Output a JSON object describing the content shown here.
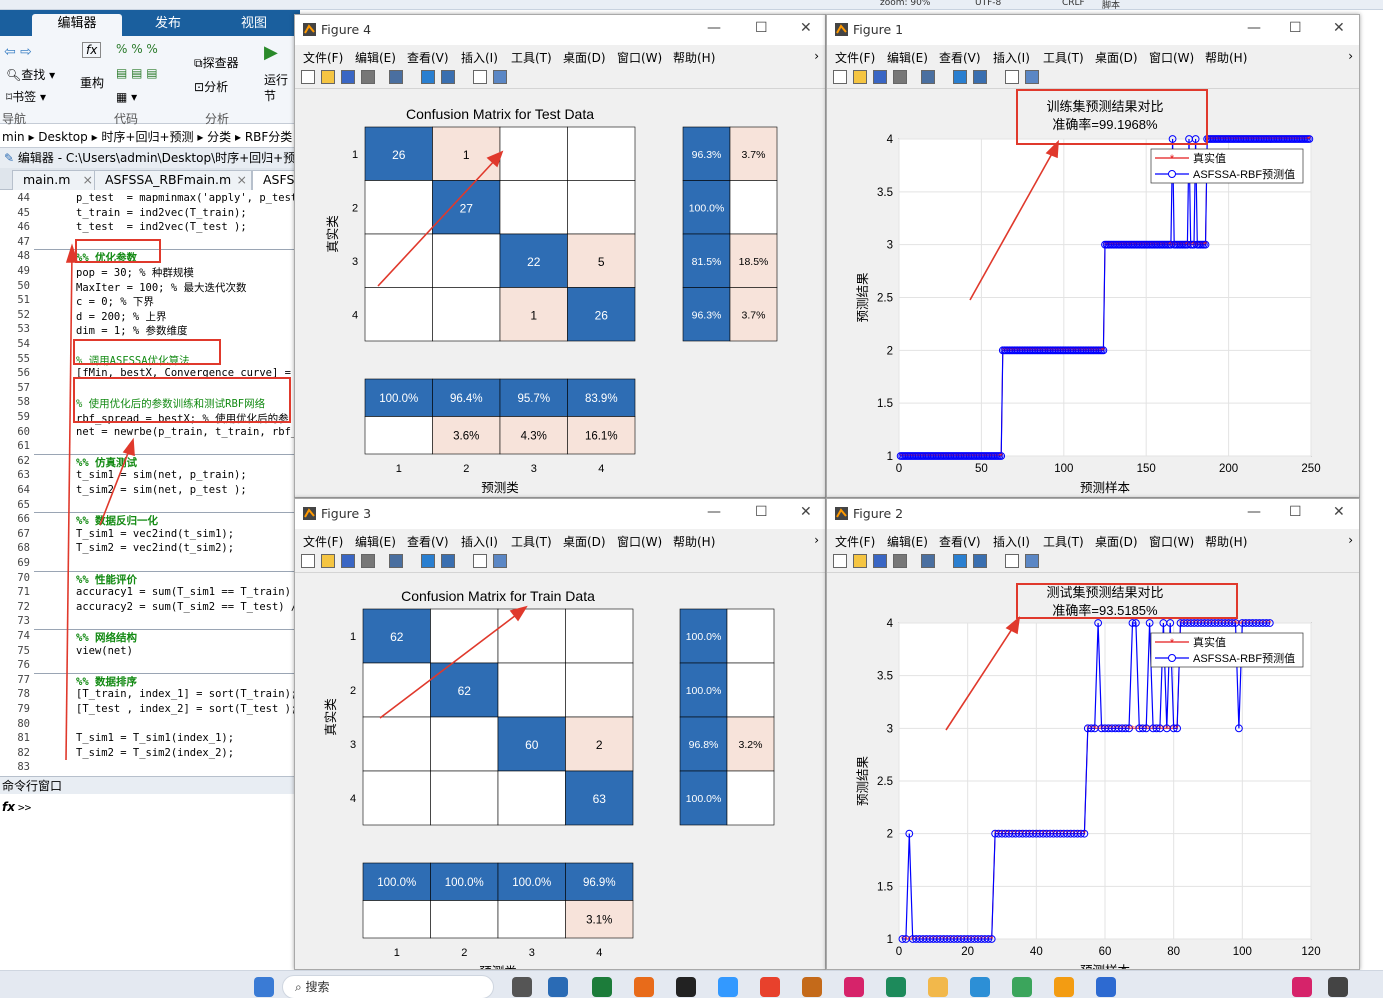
{
  "top_strip": {
    "items": [
      "zoom: 90%",
      "UTF-8",
      "CRLF",
      "脚本"
    ]
  },
  "matlab": {
    "tabs": [
      "编辑器",
      "发布",
      "视图"
    ],
    "ribbon": {
      "find": "查找",
      "bookmark": "书签",
      "refactor": "重构",
      "explorer": "探查器",
      "analyze": "分析",
      "run": "运行\n节",
      "groups": [
        "导航",
        "代码",
        "分析"
      ]
    },
    "breadcrumb": "min ▸ Desktop ▸ 时序+回归+预测 ▸ 分类 ▸ RBF分类",
    "editor_title": "编辑器 - C:\\Users\\admin\\Desktop\\时序+回归+预测\\",
    "file_tabs": [
      "main.m",
      "ASFSSA_RBFmain.m",
      "ASFSS"
    ],
    "code_lines": [
      {
        "n": "44",
        "t": "p_test  = mapminmax('apply', p_test",
        "k": "code"
      },
      {
        "n": "45",
        "t": "t_train = ind2vec(T_train);",
        "k": "code"
      },
      {
        "n": "46",
        "t": "t_test  = ind2vec(T_test );",
        "k": "code"
      },
      {
        "n": "47",
        "t": "",
        "k": "code"
      },
      {
        "n": "48",
        "t": "%% 优化参数",
        "k": "sec"
      },
      {
        "n": "49",
        "t": "pop = 30; % 种群规模",
        "k": "code"
      },
      {
        "n": "50",
        "t": "MaxIter = 100; % 最大迭代次数",
        "k": "code"
      },
      {
        "n": "51",
        "t": "c = 0; % 下界",
        "k": "code"
      },
      {
        "n": "52",
        "t": "d = 200; % 上界",
        "k": "code"
      },
      {
        "n": "53",
        "t": "dim = 1; % 参数维度",
        "k": "code"
      },
      {
        "n": "54",
        "t": "",
        "k": "code"
      },
      {
        "n": "55",
        "t": "% 调用ASFSSA优化算法",
        "k": "cm"
      },
      {
        "n": "56",
        "t": "[fMin, bestX, Convergence_curve] =",
        "k": "code"
      },
      {
        "n": "57",
        "t": "",
        "k": "code"
      },
      {
        "n": "58",
        "t": "% 使用优化后的参数训练和测试RBF网络",
        "k": "cm"
      },
      {
        "n": "59",
        "t": "rbf_spread = bestX; % 使用优化后的参",
        "k": "code"
      },
      {
        "n": "60",
        "t": "net = newrbe(p_train, t_train, rbf_",
        "k": "code"
      },
      {
        "n": "61",
        "t": "",
        "k": "code"
      },
      {
        "n": "62",
        "t": "%% 仿真测试",
        "k": "sec"
      },
      {
        "n": "63",
        "t": "t_sim1 = sim(net, p_train);",
        "k": "code"
      },
      {
        "n": "64",
        "t": "t_sim2 = sim(net, p_test );",
        "k": "code"
      },
      {
        "n": "65",
        "t": "",
        "k": "code"
      },
      {
        "n": "66",
        "t": "%% 数据反归一化",
        "k": "sec"
      },
      {
        "n": "67",
        "t": "T_sim1 = vec2ind(t_sim1);",
        "k": "code"
      },
      {
        "n": "68",
        "t": "T_sim2 = vec2ind(t_sim2);",
        "k": "code"
      },
      {
        "n": "69",
        "t": "",
        "k": "code"
      },
      {
        "n": "70",
        "t": "%% 性能评价",
        "k": "sec"
      },
      {
        "n": "71",
        "t": "accuracy1 = sum(T_sim1 == T_train)",
        "k": "code"
      },
      {
        "n": "72",
        "t": "accuracy2 = sum(T_sim2 == T_test) /",
        "k": "code"
      },
      {
        "n": "73",
        "t": "",
        "k": "code"
      },
      {
        "n": "74",
        "t": "%% 网络结构",
        "k": "sec"
      },
      {
        "n": "75",
        "t": "view(net)",
        "k": "code"
      },
      {
        "n": "76",
        "t": "",
        "k": "code"
      },
      {
        "n": "77",
        "t": "%% 数据排序",
        "k": "sec"
      },
      {
        "n": "78",
        "t": "[T_train, index_1] = sort(T_train);",
        "k": "code"
      },
      {
        "n": "79",
        "t": "[T_test , index_2] = sort(T_test );",
        "k": "code"
      },
      {
        "n": "80",
        "t": "",
        "k": "code"
      },
      {
        "n": "81",
        "t": "T_sim1 = T_sim1(index_1);",
        "k": "code"
      },
      {
        "n": "82",
        "t": "T_sim2 = T_sim2(index_2);",
        "k": "code"
      },
      {
        "n": "83",
        "t": "",
        "k": "code"
      }
    ],
    "command_window_title": "命令行窗口",
    "prompt": ">>"
  },
  "figure_menu": [
    "文件(F)",
    "编辑(E)",
    "查看(V)",
    "插入(I)",
    "工具(T)",
    "桌面(D)",
    "窗口(W)",
    "帮助(H)"
  ],
  "figures": {
    "fig4": {
      "title": "Figure 4",
      "chart_title": "Confusion Matrix for Test Data",
      "xlabel": "预测类",
      "ylabel": "真实类"
    },
    "fig3": {
      "title": "Figure 3",
      "chart_title": "Confusion Matrix for Train Data",
      "xlabel": "预测类",
      "ylabel": "真实类"
    },
    "fig1": {
      "title": "Figure 1",
      "chart_title": "训练集预测结果对比",
      "accuracy": "准确率=99.1968%",
      "xlabel": "预测样本",
      "ylabel": "预测结果",
      "legend": [
        "真实值",
        "ASFSSA-RBF预测值"
      ]
    },
    "fig2": {
      "title": "Figure 2",
      "chart_title": "测试集预测结果对比",
      "accuracy": "准确率=93.5185%",
      "xlabel": "预测样本",
      "ylabel": "预测结果",
      "legend": [
        "真实值",
        "ASFSSA-RBF预测值"
      ]
    }
  },
  "taskbar": {
    "search": "搜索"
  },
  "chart_data": [
    {
      "type": "heatmap",
      "title": "Confusion Matrix for Test Data",
      "xlabel": "预测类",
      "ylabel": "真实类",
      "classes": [
        "1",
        "2",
        "3",
        "4"
      ],
      "matrix": [
        [
          26,
          1,
          0,
          0
        ],
        [
          0,
          27,
          0,
          0
        ],
        [
          0,
          0,
          22,
          5
        ],
        [
          0,
          0,
          1,
          26
        ]
      ],
      "row_summary": [
        [
          "96.3%",
          "3.7%"
        ],
        [
          "100.0%",
          ""
        ],
        [
          "81.5%",
          "18.5%"
        ],
        [
          "96.3%",
          "3.7%"
        ]
      ],
      "col_summary": [
        [
          "100.0%",
          ""
        ],
        [
          "96.4%",
          "3.6%"
        ],
        [
          "95.7%",
          "4.3%"
        ],
        [
          "83.9%",
          "16.1%"
        ]
      ]
    },
    {
      "type": "heatmap",
      "title": "Confusion Matrix for Train Data",
      "xlabel": "预测类",
      "ylabel": "真实类",
      "classes": [
        "1",
        "2",
        "3",
        "4"
      ],
      "matrix": [
        [
          62,
          0,
          0,
          0
        ],
        [
          0,
          62,
          0,
          0
        ],
        [
          0,
          0,
          60,
          2
        ],
        [
          0,
          0,
          0,
          63
        ]
      ],
      "row_summary": [
        [
          "100.0%",
          ""
        ],
        [
          "100.0%",
          ""
        ],
        [
          "96.8%",
          "3.2%"
        ],
        [
          "100.0%",
          ""
        ]
      ],
      "col_summary": [
        [
          "100.0%",
          ""
        ],
        [
          "100.0%",
          ""
        ],
        [
          "100.0%",
          ""
        ],
        [
          "96.9%",
          "3.1%"
        ]
      ]
    },
    {
      "type": "line",
      "title": "训练集预测结果对比",
      "subtitle": "准确率=99.1968%",
      "xlabel": "预测样本",
      "ylabel": "预测结果",
      "xlim": [
        0,
        250
      ],
      "ylim": [
        1,
        4
      ],
      "xticks": [
        0,
        50,
        100,
        150,
        200,
        250
      ],
      "yticks": [
        1,
        1.5,
        2,
        2.5,
        3,
        3.5,
        4
      ],
      "grid": true,
      "legend_position": "top-right",
      "true_steps": [
        [
          1,
          1
        ],
        [
          63,
          2
        ],
        [
          125,
          3
        ],
        [
          187,
          4
        ],
        [
          249,
          4
        ]
      ],
      "series": [
        {
          "name": "真实值",
          "color": "#e41a1c"
        },
        {
          "name": "ASFSSA-RBF预测值",
          "color": "#0000ff"
        }
      ],
      "pred_mismatches": [
        [
          166,
          4
        ],
        [
          176,
          4
        ],
        [
          180,
          4
        ]
      ]
    },
    {
      "type": "line",
      "title": "测试集预测结果对比",
      "subtitle": "准确率=93.5185%",
      "xlabel": "预测样本",
      "ylabel": "预测结果",
      "xlim": [
        0,
        120
      ],
      "ylim": [
        1,
        4
      ],
      "xticks": [
        0,
        20,
        40,
        60,
        80,
        100,
        120
      ],
      "yticks": [
        1,
        1.5,
        2,
        2.5,
        3,
        3.5,
        4
      ],
      "grid": true,
      "legend_position": "top-right",
      "true_steps": [
        [
          1,
          1
        ],
        [
          28,
          2
        ],
        [
          55,
          3
        ],
        [
          82,
          4
        ],
        [
          108,
          4
        ]
      ],
      "series": [
        {
          "name": "真实值",
          "color": "#e41a1c"
        },
        {
          "name": "ASFSSA-RBF预测值",
          "color": "#0000ff"
        }
      ],
      "pred_mismatches": [
        [
          3,
          2
        ],
        [
          58,
          4
        ],
        [
          68,
          4
        ],
        [
          69,
          4
        ],
        [
          73,
          4
        ],
        [
          77,
          4
        ],
        [
          79,
          4
        ],
        [
          99,
          3
        ]
      ]
    }
  ],
  "colors": {
    "accent": "#2e6db4",
    "light": "#f7e3da",
    "arrow": "#e0392c",
    "highlight_box": "#e0392c"
  }
}
